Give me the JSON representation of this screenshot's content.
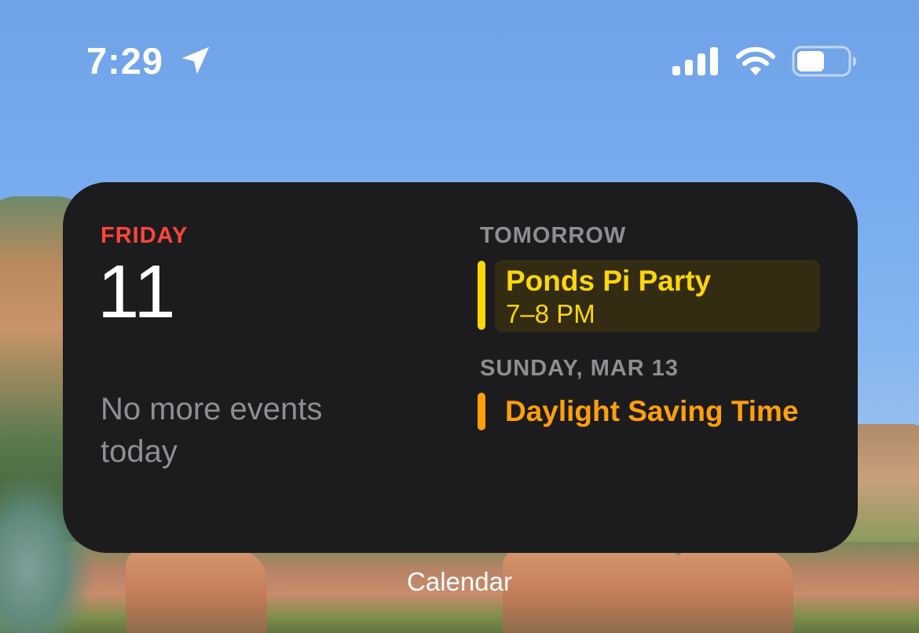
{
  "status_bar": {
    "time": "7:29",
    "icons": [
      "location-arrow-icon",
      "cellular-signal-icon",
      "wifi-icon",
      "battery-icon"
    ]
  },
  "widget": {
    "today": {
      "weekday": "FRIDAY",
      "day_number": "11",
      "message": "No more events today"
    },
    "sections": [
      {
        "label": "TOMORROW",
        "events": [
          {
            "title": "Ponds Pi Party",
            "time": "7–8 PM",
            "color": "#ffd60a"
          }
        ]
      },
      {
        "label": "SUNDAY, MAR 13",
        "events": [
          {
            "title": "Daylight Saving Time",
            "color": "#ff9f0a"
          }
        ]
      }
    ],
    "caption": "Calendar"
  },
  "colors": {
    "widget_bg": "#1c1c1e",
    "weekday_red": "#ff453a",
    "event_yellow": "#ffd60a",
    "event_orange": "#ff9f0a",
    "secondary_gray": "#8e8e93"
  }
}
